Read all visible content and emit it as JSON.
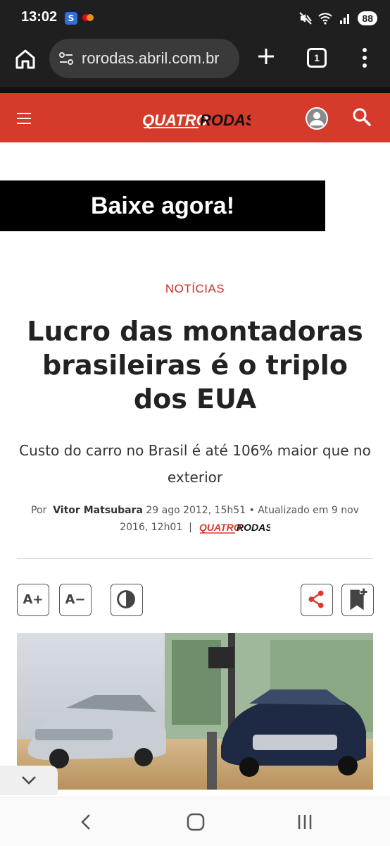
{
  "status_bar": {
    "time": "13:02",
    "app_icon_1": "S",
    "battery": "88",
    "icons": [
      "mute-icon",
      "wifi-icon",
      "signal-icon"
    ]
  },
  "browser": {
    "url": "rorodas.abril.com.br",
    "tab_count": "1"
  },
  "site": {
    "logo_text_1": "QUATRO",
    "logo_text_2": "RODAS",
    "brand_color": "#d63a2b"
  },
  "ad": {
    "text": "Baixe agora!"
  },
  "article": {
    "category": "NOTÍCIAS",
    "headline": "Lucro das montadoras brasileiras é o triplo dos EUA",
    "subtitle": "Custo do carro no Brasil é até 106% maior que no exterior",
    "byline_prefix": "Por",
    "author": "Vitor Matsubara",
    "published": "29 ago 2012, 15h51",
    "updated": "• Atualizado em 9 nov 2016, 12h01",
    "separator": "|"
  },
  "toolbar": {
    "font_increase": "A+",
    "font_decrease": "A−"
  }
}
